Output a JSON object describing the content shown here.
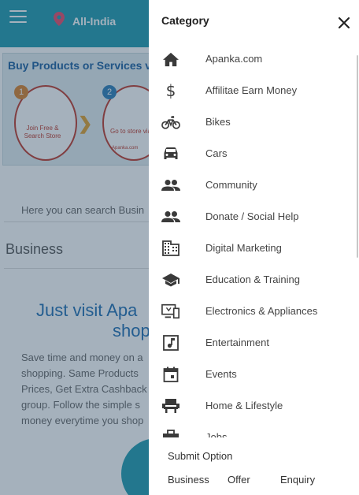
{
  "header": {
    "location": "All-India"
  },
  "banner": {
    "title": "Buy Products or Services v",
    "step1_text": "Join Free & Search Store",
    "step2_text": "Go to store via",
    "step2_site": "Apanka.com",
    "step1_num": "1",
    "step2_num": "2"
  },
  "background": {
    "search_hint": "Here you can search Busin",
    "section_title": "Business",
    "visit_line1": "Just visit Apa",
    "visit_line2": "shop",
    "body_lines": [
      "Save time and money on a",
      "shopping. Same Products",
      "Prices, Get Extra Cashback",
      "group. Follow the simple s",
      "money everytime you shop"
    ]
  },
  "drawer": {
    "title": "Category",
    "categories": [
      {
        "label": "Apanka.com",
        "icon": "home-icon"
      },
      {
        "label": "Affilitae Earn Money",
        "icon": "dollar-icon"
      },
      {
        "label": "Bikes",
        "icon": "bike-icon"
      },
      {
        "label": "Cars",
        "icon": "car-icon"
      },
      {
        "label": "Community",
        "icon": "people-icon"
      },
      {
        "label": "Donate / Social Help",
        "icon": "people-icon"
      },
      {
        "label": "Digital Marketing",
        "icon": "building-icon"
      },
      {
        "label": "Education & Training",
        "icon": "school-icon"
      },
      {
        "label": "Electronics & Appliances",
        "icon": "devices-icon"
      },
      {
        "label": "Entertainment",
        "icon": "music-icon"
      },
      {
        "label": "Events",
        "icon": "calendar-icon"
      },
      {
        "label": "Home & Lifestyle",
        "icon": "chair-icon"
      },
      {
        "label": "Jobs",
        "icon": "briefcase-icon"
      }
    ],
    "submit_label": "Submit Option",
    "submit_options": [
      "Business",
      "Offer",
      "Enquiry"
    ]
  },
  "colors": {
    "brand": "#1f9bb0",
    "overlay": "rgba(40,70,95,0.42)"
  }
}
